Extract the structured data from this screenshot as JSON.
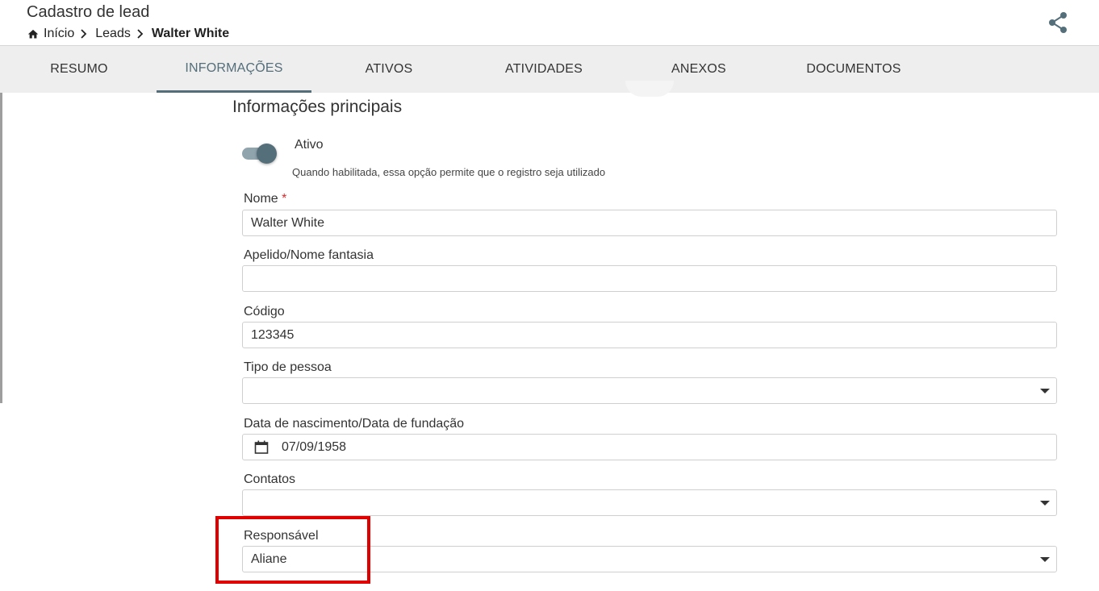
{
  "header": {
    "title": "Cadastro de lead",
    "breadcrumb": [
      "Início",
      "Leads",
      "Walter White"
    ]
  },
  "tabs": [
    "RESUMO",
    "INFORMAÇÕES",
    "ATIVOS",
    "ATIVIDADES",
    "ANEXOS",
    "DOCUMENTOS"
  ],
  "active_tab": "INFORMAÇÕES",
  "section_title": "Informações principais",
  "toggle": {
    "label": "Ativo",
    "hint": "Quando habilitada, essa opção permite que o registro seja utilizado",
    "on": true
  },
  "fields": {
    "nome": {
      "label": "Nome",
      "required_mark": "*",
      "value": "Walter White"
    },
    "apelido": {
      "label": "Apelido/Nome fantasia",
      "value": ""
    },
    "codigo": {
      "label": "Código",
      "value": "123345"
    },
    "tipo_pessoa": {
      "label": "Tipo de pessoa",
      "value": ""
    },
    "data_nascimento": {
      "label": "Data de nascimento/Data de fundação",
      "value": "07/09/1958"
    },
    "contatos": {
      "label": "Contatos",
      "value": ""
    },
    "responsavel": {
      "label": "Responsável",
      "value": "Aliane"
    }
  },
  "colors": {
    "accent": "#546e7a",
    "highlight": "#e00000",
    "required": "#d32f2f",
    "tabbar": "#eeeeee"
  },
  "icons": [
    "home-icon",
    "chevron-right-icon",
    "share-icon",
    "calendar-icon",
    "dropdown-arrow-icon"
  ]
}
